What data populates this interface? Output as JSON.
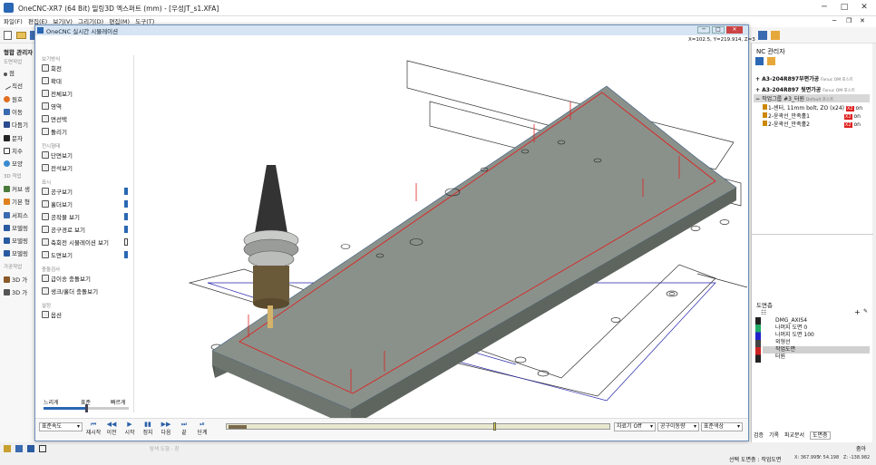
{
  "app": {
    "title": "OneCNC-XR7 (64 Bit) 밀링3D 엑스퍼트 (mm) - [우성JT_s1.XFA]"
  },
  "menu": [
    "파일(F)",
    "편집(E)",
    "보기(V)",
    "그리기(D)",
    "편집(M)",
    "도구(T)"
  ],
  "left_panel": {
    "header": "형합 관리자",
    "sections": [
      "도면작업",
      "3D 작업",
      "가공작업"
    ],
    "items": [
      "점",
      "직선",
      "원호",
      "이동",
      "다듬기",
      "문자",
      "치수",
      "모양",
      "커브 생",
      "기본 형",
      "서피스",
      "모델링",
      "모델링",
      "모델링",
      "3D 가",
      "3D 가"
    ]
  },
  "sim": {
    "title": "OneCNC 실시간 시뮬레이션",
    "coords": "X=102.5, Y=219.914, Z=3",
    "sections": {
      "view": "보기방식",
      "display": "전시형태",
      "show": "표시",
      "collision": "충돌검사",
      "etc": "설정"
    },
    "view_items": [
      "회전",
      "확대",
      "전체보기",
      "영역",
      "면선택",
      "돌리기"
    ],
    "display_items": [
      "단면보기",
      "전석보기"
    ],
    "show_items": [
      {
        "label": "공구보기",
        "on": true
      },
      {
        "label": "홀더보기",
        "on": true
      },
      {
        "label": "공작물 보기",
        "on": true
      },
      {
        "label": "공구경로 보기",
        "on": true
      },
      {
        "label": "축회전 시뮬레이션 보기",
        "on": false
      },
      {
        "label": "도면보기",
        "on": true
      }
    ],
    "collision_items": [
      "급이송 충돌보기",
      "생크/홀더 충돌보기"
    ],
    "etc_items": [
      "옵션"
    ],
    "speed": {
      "slow": "느리게",
      "normal": "표준",
      "fast": "빠르게",
      "value": 0.5
    },
    "controls": {
      "speed_select": "표준속도",
      "buttons": [
        "재시작",
        "이전",
        "시작",
        "정지",
        "다음",
        "끝",
        "단계"
      ],
      "sel1": "자료기 Off",
      "sel2": "공구이동량",
      "sel3": "표준색상",
      "progress": 0.7
    }
  },
  "nc_manager": {
    "title": "NC 관리자",
    "items": [
      {
        "label": "A3-204R897부편가공",
        "sub": "Fanuc OM 포스트",
        "kind": "group"
      },
      {
        "label": "A3-204R897 뒷면가공",
        "sub": "Fanuc OM 포스트",
        "kind": "group"
      },
      {
        "label": "작업그룹 #3_터원",
        "sub": "Default 포스트",
        "kind": "group-selected"
      },
      {
        "label": "1-센터, 11mm bolt, ZO (x24)",
        "badge": "on",
        "kind": "op"
      },
      {
        "label": "2-윤곽선_만족홀1",
        "badge": "on",
        "kind": "op"
      },
      {
        "label": "2-윤곽선_만족홀2",
        "badge": "on",
        "kind": "op"
      }
    ]
  },
  "layers": {
    "title": "도면층",
    "items": [
      "DMG_AXIS4",
      "나머지 도면 0",
      "나머지 도면 100",
      "외형선",
      "작업도면",
      "터원"
    ],
    "tabs": [
      "검증",
      "기록",
      "파교분서",
      "도면층"
    ]
  },
  "status": {
    "zoom_label": "줌아",
    "layer": "선택 도면층 : 작업도면",
    "x": "X: 367.995",
    "y": "Y: 54.198",
    "z": "Z: -138.982",
    "left_text": "탐색 도형 - 창"
  },
  "colors": {
    "accent": "#2a67b4",
    "toolpath": "#d22",
    "plate": "#8a918a"
  }
}
